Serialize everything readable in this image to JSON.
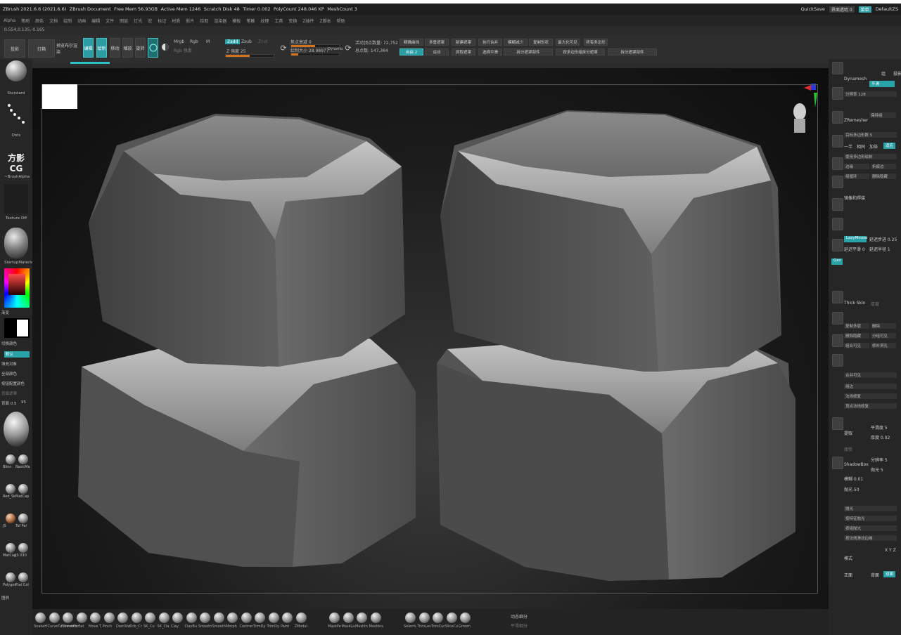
{
  "titlebar": {
    "app": "ZBrush 2021.6.6 (2021.6.6)",
    "document": "ZBrush Document",
    "free_mem": "Free Mem 56.93GB",
    "active_mem": "Active Mem 1246",
    "scratch": "Scratch Disk 48",
    "timer": "Timer 0.002",
    "polycount": "PolyCount 248.046 KP",
    "meshcount": "MeshCount 3",
    "quicksave": "QuickSave",
    "transparency": "界面透明 0",
    "menus_label": "菜单",
    "default_script": "DefaultZS"
  },
  "menubar": {
    "items": [
      "Alpha",
      "笔刷",
      "颜色",
      "文档",
      "绘制",
      "动画",
      "编辑",
      "文件",
      "图层",
      "灯光",
      "宏",
      "标记",
      "材质",
      "影片",
      "拾取",
      "渲染器",
      "模板",
      "笔触",
      "纹理",
      "工具",
      "变换",
      "Z插件",
      "Z脚本",
      "帮助"
    ]
  },
  "coords": "0.554,0.135,-0.165",
  "toolbar": {
    "projection": "投影",
    "lightbox": "灯箱",
    "quick_sketch": "预览布尔渲染",
    "edit": "编辑",
    "draw": "绘制",
    "move": "移动",
    "scale": "缩放",
    "rotate": "旋转",
    "mrgb": "Mrgb",
    "rgb": "Rgb",
    "m": "M",
    "rgb_intensity": "Rgb 强度",
    "zadd": "Zadd",
    "zsub": "Zsub",
    "zcut": "Zcut",
    "z_intensity": "Z 强度 25",
    "focal_shift": "焦点衰减 0",
    "draw_size": "绘制大小 28.98977",
    "dynamic": "Dynamic",
    "active_points": "活动顶点数量: 72,752",
    "total_points": "总点数: 147,364",
    "buttons_row1": [
      "精确曲线",
      "多重遮罩",
      "新建遮罩",
      "执行合并",
      "模糊减少",
      "复制形状",
      "最大化可见",
      "所有多边形"
    ],
    "buttons_row2": [
      "自由 2",
      "运动",
      "抓取遮罩",
      "选择平滑",
      "拆分遮罩部件",
      "按多边形组拆分遮罩",
      "拆分遮罩部件"
    ]
  },
  "lefttray": {
    "brush": "Standard",
    "stroke": "Dots",
    "logo": "方影CG",
    "alpha": "~BrushAlpha",
    "texture": "Texture Off",
    "material": "StartupMaterial",
    "gradient": "渐变",
    "switch_color": "切换颜色",
    "btn_teal": "默认",
    "items": [
      "填充对象",
      "全部颜色",
      "按钮配置颜色"
    ],
    "backface": "背面遮罩",
    "intensity": "背面 0.5",
    "intensity_val": "95",
    "materials": [
      {
        "a": "Blinn",
        "b": "BasicMa"
      },
      {
        "a": "Red_Sk",
        "b": "MatCap"
      },
      {
        "a": "JS",
        "b": "Tof Pai"
      },
      {
        "a": "MatCap",
        "b": "JS 030"
      },
      {
        "a": "Polygon",
        "b": "Flat Col"
      }
    ],
    "bottom": "图例"
  },
  "righttray": {
    "dynamesh": "Dynamesh",
    "group": "组",
    "polish": "投影",
    "smooth_label": "平滑",
    "resolution": "分辨率 128",
    "zremesher": "ZRemesher",
    "keep_groups": "保持组",
    "target_count": "目标多边形数 5",
    "half": "一半",
    "same": "相同",
    "double": "加倍",
    "adapt": "适应",
    "use_polypaint": "使用多边形绘制",
    "edge_loop": "边缘",
    "crease": "折痕边",
    "group_loops": "组循环",
    "delete_hidden": "删除隐藏",
    "mirror": "镜像和焊接",
    "lazy_mouse": "LazyMouse",
    "lazy_step": "延迟步进 0.25",
    "lazy_smooth": "延迟平滑 0",
    "lazy_radius": "延迟半径 1",
    "qxz": "Qxz",
    "thick_skin": "Thick Skin",
    "thick_val": "厚度",
    "items_a": [
      "复制多层",
      "删除",
      "删除隐藏",
      "分组可见",
      "组合可见",
      "修补洞孔"
    ],
    "subtool_merge": "合并可见",
    "extract": "提取",
    "extract_smooth": "平滑度 5",
    "extract_thick": "厚度 0.02",
    "accept": "接受",
    "shadowbox": "ShadowBox",
    "res": "分辨率 5",
    "polish2": "抛光 5",
    "blur": "模糊 0.01",
    "polish_val": "抛光 50",
    "items_b": [
      "抛光",
      "按特征抛光",
      "按组抛光",
      "按法线滑动边缘"
    ],
    "xyz": "X Y Z",
    "mode": "模式",
    "front": "正面",
    "back": "背面",
    "both": "双面",
    "bottom1": "组边",
    "bottom2": "法线修复",
    "bottom3": "顶点法线修复"
  },
  "shelf": {
    "brushes": [
      "SnakeH",
      "",
      "ClayBuildup",
      "CurveTube",
      "CurveExtrude",
      "Inflat",
      "Move Tc",
      "Pinch",
      "DamStd",
      "Orb_Cra",
      "SK_Cu",
      "SK_Cla",
      "Clay",
      "ClayBu",
      "Smooth",
      "Smooth",
      "Morph",
      "Contrac",
      "TrimDy",
      "TrimDy",
      "Paint",
      "ZModel",
      "",
      "MaskPe",
      "MaskCir",
      "MeshIns",
      "Select",
      "TrimLas",
      "TrimCur",
      "SliceCu",
      "Groom"
    ],
    "brush_labels": [
      "SnakeH",
      "CurveTu CurveEx",
      "Extrude",
      "Inflat",
      "Move T",
      "Pinch",
      "DamStd",
      "Orb_Cr",
      "SK_Cu",
      "SK_Cla",
      "Clay",
      "ClayBu",
      "Smooth",
      "Smooth",
      "Morph",
      "Contrac",
      "TrimDy",
      "TrimDy",
      "Paint",
      "ZModel",
      "MaskPe",
      "MaskLa",
      "MeshIn",
      "MeshIns",
      "SelectL",
      "TrimLas",
      "TrimCur",
      "SliceCu",
      "Groom"
    ],
    "right1": "动态细分",
    "right2": "平滑细分"
  }
}
